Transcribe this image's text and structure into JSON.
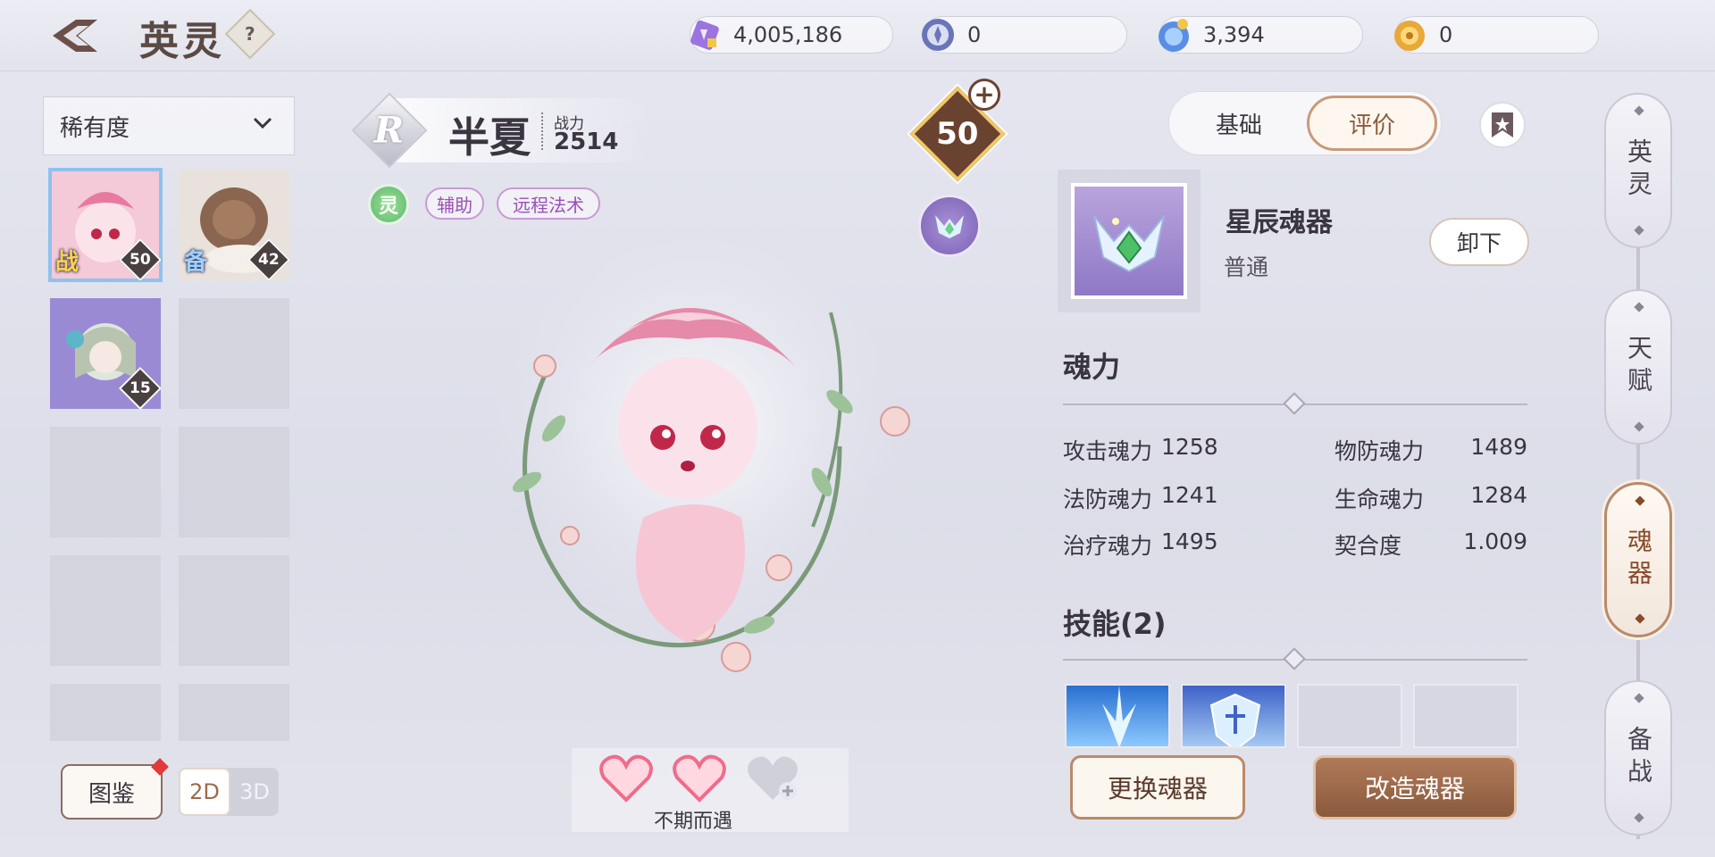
{
  "header": {
    "title": "英灵",
    "help_label": "?",
    "currencies": [
      {
        "icon": "crystal-ticket-icon",
        "value": "4,005,186"
      },
      {
        "icon": "silver-coin-icon",
        "value": "0"
      },
      {
        "icon": "blue-spirit-coin-icon",
        "value": "3,394"
      },
      {
        "icon": "gold-coin-icon",
        "value": "0"
      }
    ]
  },
  "sidebar": {
    "sort_label": "稀有度",
    "heroes": [
      {
        "tag": "战",
        "level": "50"
      },
      {
        "tag": "备",
        "level": "42"
      },
      {
        "tag": "",
        "level": "15"
      }
    ],
    "codex_label": "图鉴",
    "mode_2d": "2D",
    "mode_3d": "3D"
  },
  "hero": {
    "rarity": "R",
    "name": "半夏",
    "power_label": "战力",
    "power": "2514",
    "element": "灵",
    "tags": [
      "辅助",
      "远程法术"
    ],
    "level": "50",
    "affection_label": "不期而遇",
    "affection": {
      "filled": 2,
      "total": 3
    }
  },
  "panel": {
    "tabs": [
      "基础",
      "评价"
    ],
    "active_tab": "评价",
    "equip": {
      "name": "星辰魂器",
      "quality": "普通",
      "unequip_label": "卸下"
    },
    "soul_power_title": "魂力",
    "stats": [
      {
        "label": "攻击魂力",
        "value": "1258"
      },
      {
        "label": "物防魂力",
        "value": "1489"
      },
      {
        "label": "法防魂力",
        "value": "1241"
      },
      {
        "label": "生命魂力",
        "value": "1284"
      },
      {
        "label": "治疗魂力",
        "value": "1495"
      },
      {
        "label": "契合度",
        "value": "1.009"
      }
    ],
    "skills_title": "技能(2)",
    "swap_label": "更换魂器",
    "reforge_label": "改造魂器"
  },
  "side_nav": {
    "items": [
      "英灵",
      "天赋",
      "魂器",
      "备战"
    ],
    "active": "魂器"
  },
  "colors": {
    "accent": "#b98a6a",
    "tag_purple": "#9a4fb6",
    "level_badge": "#6a4230"
  }
}
